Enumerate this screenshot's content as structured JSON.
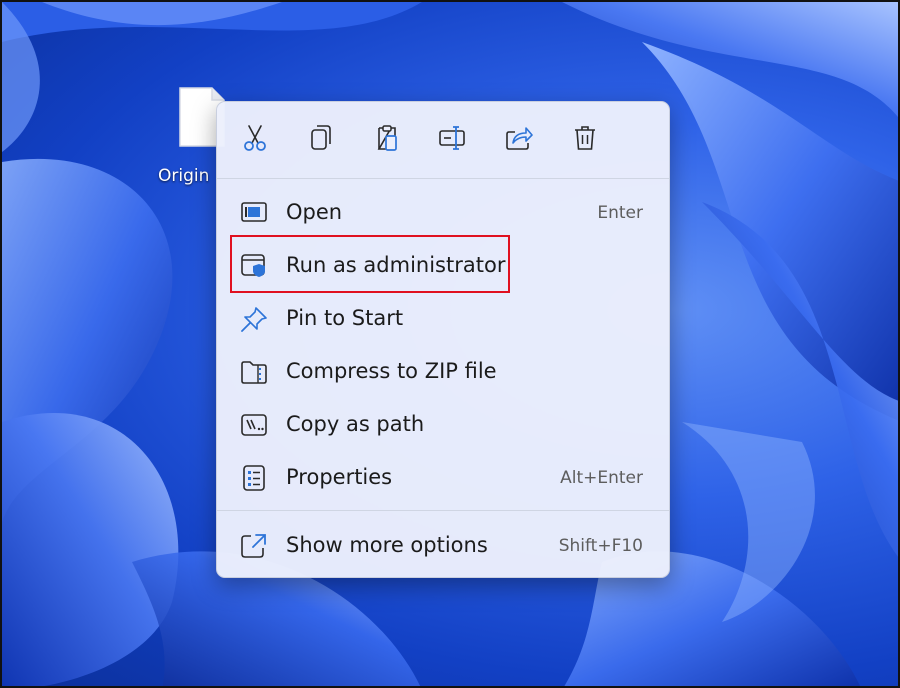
{
  "desktop": {
    "file_label": "Origin",
    "file_icon": "document-icon"
  },
  "context_menu": {
    "toolbar": [
      {
        "name": "cut-icon",
        "action": "Cut"
      },
      {
        "name": "copy-icon",
        "action": "Copy"
      },
      {
        "name": "paste-icon",
        "action": "Paste"
      },
      {
        "name": "rename-icon",
        "action": "Rename"
      },
      {
        "name": "share-icon",
        "action": "Share"
      },
      {
        "name": "delete-icon",
        "action": "Delete"
      }
    ],
    "items": [
      {
        "label": "Open",
        "shortcut": "Enter",
        "icon": "open-icon"
      },
      {
        "label": "Run as administrator",
        "shortcut": "",
        "icon": "shield-window-icon"
      },
      {
        "label": "Pin to Start",
        "shortcut": "",
        "icon": "pin-icon"
      },
      {
        "label": "Compress to ZIP file",
        "shortcut": "",
        "icon": "zip-folder-icon"
      },
      {
        "label": "Copy as path",
        "shortcut": "",
        "icon": "copy-path-icon"
      },
      {
        "label": "Properties",
        "shortcut": "Alt+Enter",
        "icon": "properties-icon"
      }
    ],
    "more": {
      "label": "Show more options",
      "shortcut": "Shift+F10",
      "icon": "external-link-icon"
    }
  },
  "annotation": {
    "highlight_color": "#e01020",
    "highlighted_item": "Run as administrator"
  },
  "colors": {
    "accent": "#2d74d8",
    "menu_bg": "#eceffc",
    "wallpaper": "#1b4fd8"
  }
}
